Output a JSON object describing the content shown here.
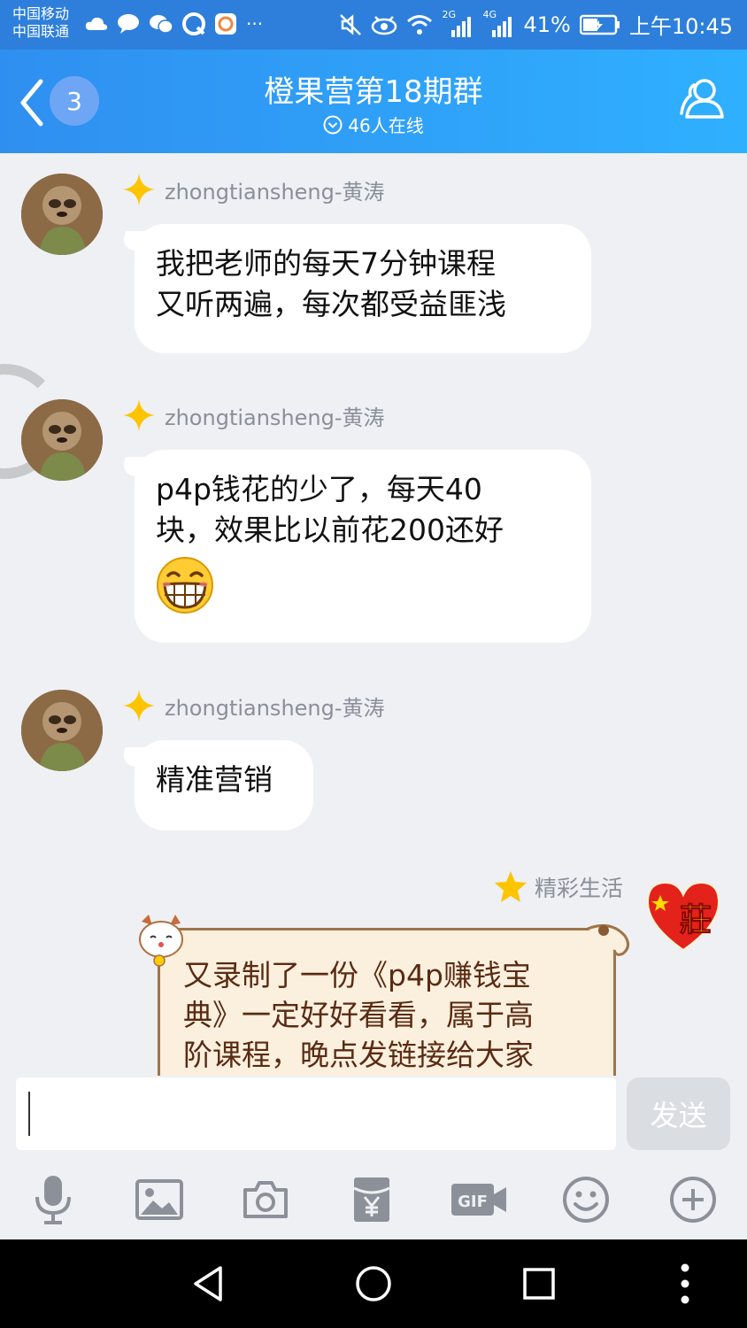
{
  "status_bar": {
    "carrier1": "中国移动",
    "carrier2": "中国联通",
    "net_2g": "2G",
    "net_4g": "4G",
    "battery": "41%",
    "time": "上午10:45"
  },
  "header": {
    "unread_count": "3",
    "title": "橙果营第18期群",
    "online": "46人在线"
  },
  "messages": [
    {
      "sender": "zhongtiansheng-黄涛",
      "line1": "我把老师的每天7分钟课程",
      "line2": "又听两遍，每次都受益匪浅"
    },
    {
      "sender": "zhongtiansheng-黄涛",
      "line1": "p4p钱花的少了，每天40",
      "line2": "块，效果比以前花200还好",
      "emoji": "grin-emoji"
    },
    {
      "sender": "zhongtiansheng-黄涛",
      "line1": "精准营销"
    }
  ],
  "sent": {
    "sender": "精彩生活",
    "avatar_text": "莊",
    "line1": "又录制了一份《p4p赚钱宝",
    "line2": "典》一定好好看看，属于高",
    "line3": "阶课程，晚点发链接给大家"
  },
  "input": {
    "send_label": "发送"
  },
  "toolbar": [
    "mic-icon",
    "image-icon",
    "camera-icon",
    "red-packet-icon",
    "gif-icon",
    "emoji-icon",
    "plus-icon"
  ],
  "colors": {
    "header_start": "#2f8ff0",
    "header_end": "#2fb0ff",
    "status_bar": "#2d7fdb",
    "chat_bg": "#eef0f4",
    "bubble": "#ffffff",
    "rank_star": "#ffc400"
  }
}
